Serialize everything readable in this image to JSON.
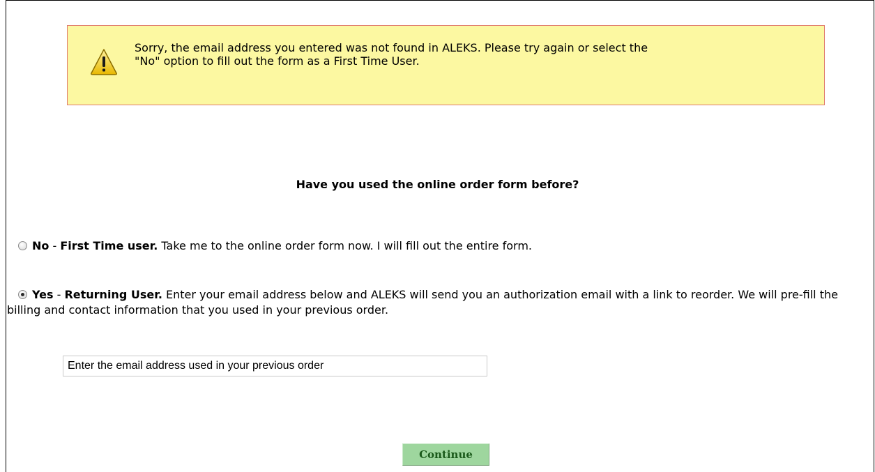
{
  "alert": {
    "icon": "warning-icon",
    "message_line1": "Sorry, the email address you entered was not found in ALEKS. Please try again or select the",
    "message_line2": "\"No\" option to fill out the form as a First Time User.",
    "background_color": "#fcf8a1",
    "border_color": "#e07a6c"
  },
  "question": "Have you used the online order form before?",
  "options": [
    {
      "lead": "No",
      "separator": " - ",
      "title": "First Time user.",
      "description": " Take me to the online order form now. I will fill out the entire form.",
      "selected": false
    },
    {
      "lead": "Yes",
      "separator": " - ",
      "title": "Returning User.",
      "description": " Enter your email address below and ALEKS will send you an authorization email with a link to reorder. We will pre-fill the billing and contact information that you used in your previous order.",
      "selected": true
    }
  ],
  "email": {
    "value": "",
    "placeholder": "Enter the email address used in your previous order"
  },
  "continue_button": {
    "label": "Continue",
    "color": "#9ed69e"
  }
}
